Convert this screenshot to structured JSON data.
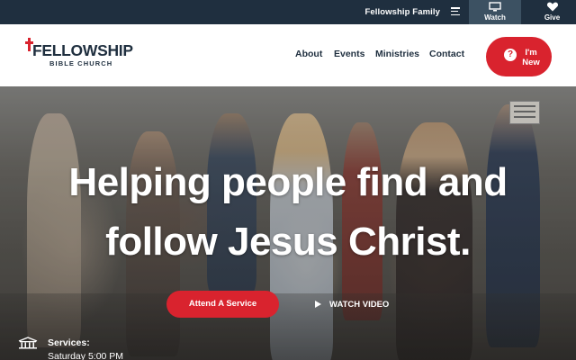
{
  "topbar": {
    "family_label": "Fellowship Family",
    "watch_label": "Watch",
    "give_label": "Give",
    "icons": [
      "menu-icon",
      "monitor-icon",
      "heart-icon"
    ]
  },
  "header": {
    "logo_name": "FELLOWSHIP",
    "logo_sub": "BIBLE CHURCH",
    "nav": {
      "about": "About",
      "events": "Events",
      "ministries": "Ministries",
      "contact": "Contact"
    },
    "new_button": {
      "label": "I'm New",
      "icon": "question-icon"
    }
  },
  "hero": {
    "headline_line1": "Helping people find and",
    "headline_line2": "follow Jesus Christ.",
    "attend_button": "Attend A Service",
    "watch_video": "WATCH VIDEO",
    "services_title": "Services:",
    "services_time": "Saturday 5:00 PM"
  },
  "colors": {
    "brand_red": "#d9232e",
    "navy": "#1f2f3f",
    "watch_bg": "#3c5162"
  }
}
